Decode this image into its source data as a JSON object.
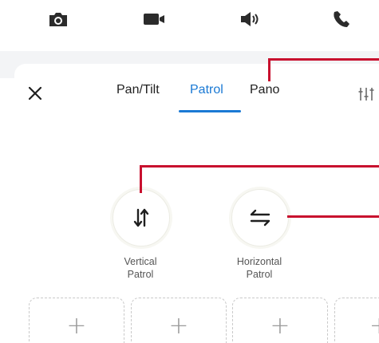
{
  "top_actions": [
    {
      "icon": "camera-icon"
    },
    {
      "icon": "video-icon"
    },
    {
      "icon": "speaker-icon"
    },
    {
      "icon": "phone-icon"
    }
  ],
  "tabs": [
    {
      "label": "Pan/Tilt"
    },
    {
      "label": "Patrol"
    },
    {
      "label": "Pano"
    }
  ],
  "active_tab": "Patrol",
  "patrols": [
    {
      "label_line1": "Vertical",
      "label_line2": "Patrol",
      "icon": "vertical-arrows-icon"
    },
    {
      "label_line1": "Horizontal",
      "label_line2": "Patrol",
      "icon": "horizontal-arrows-icon"
    }
  ],
  "slots": [
    {
      "symbol": "+"
    },
    {
      "symbol": "+"
    },
    {
      "symbol": "+"
    },
    {
      "symbol": "+"
    }
  ],
  "colors": {
    "accent": "#1a79d4",
    "annotation": "#c8102e",
    "dashed_border": "#c9c9c9"
  }
}
